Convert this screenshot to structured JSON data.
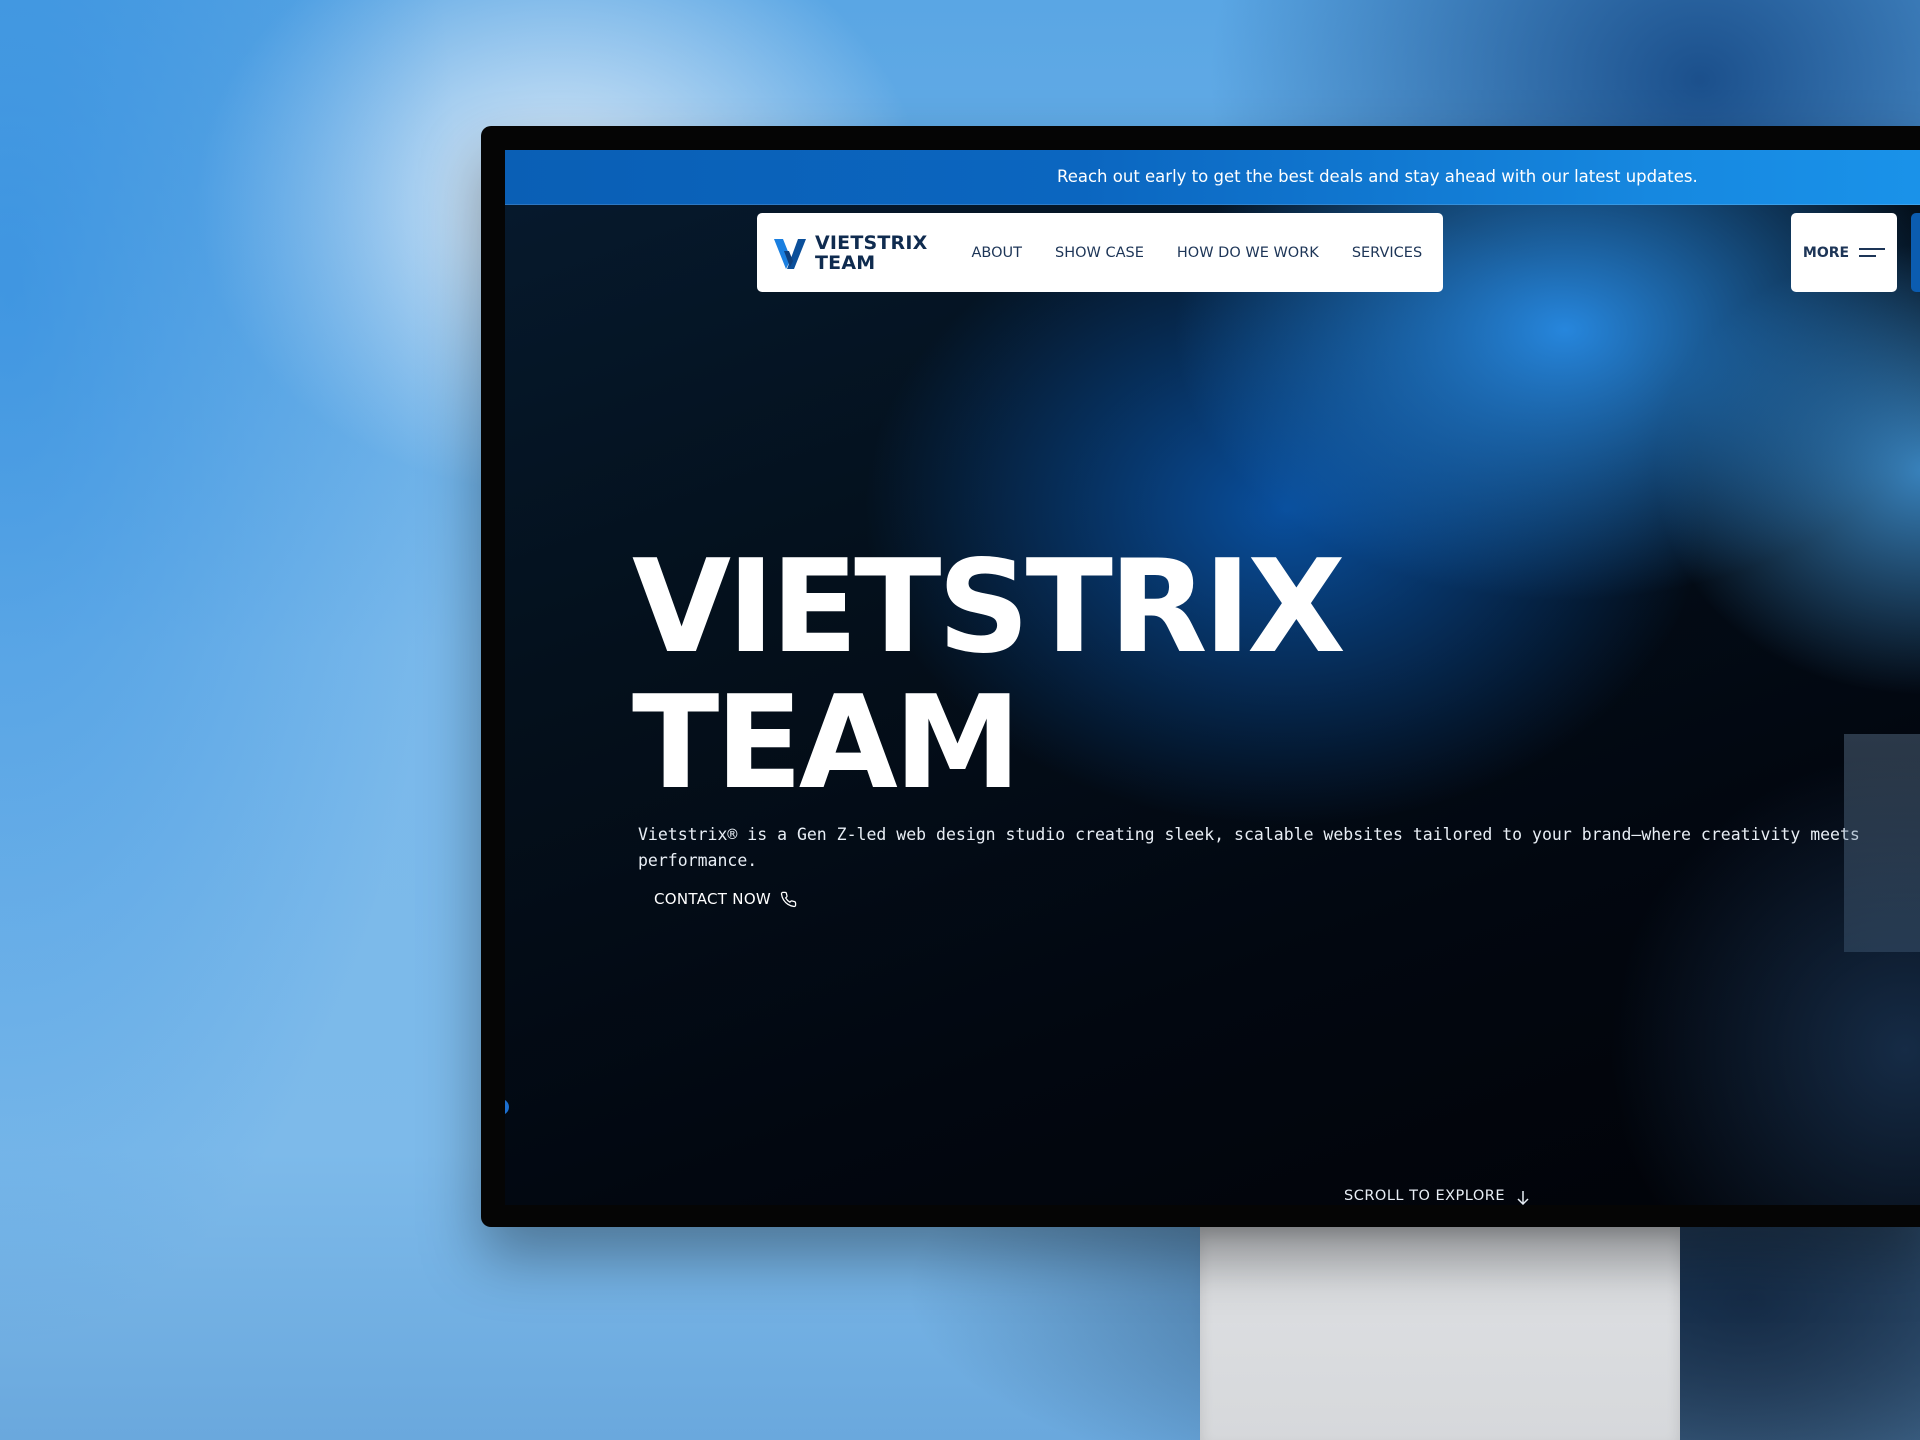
{
  "announcement": {
    "text": "Reach out early to get the best deals and stay ahead with our latest updates."
  },
  "nav": {
    "logo_line1": "VIETSTRIX",
    "logo_line2": "TEAM",
    "links": [
      {
        "label": "ABOUT"
      },
      {
        "label": "SHOW CASE"
      },
      {
        "label": "HOW DO WE WORK"
      },
      {
        "label": "SERVICES"
      }
    ],
    "more_label": "MORE"
  },
  "hero": {
    "title_line1": "VIETSTRIX",
    "title_line2": "TEAM",
    "description": "Vietstrix® is a Gen Z-led web design studio creating sleek, scalable websites tailored to your brand—where creativity meets performance.",
    "contact_label": "CONTACT NOW",
    "scroll_label": "SCROLL TO EXPLORE"
  },
  "colors": {
    "announcement_bar": "#0b66c0",
    "brand_navy": "#0f2b4f",
    "logo_blue": "#1a7fe0",
    "hero_text": "#ffffff"
  },
  "icons": {
    "logo": "v-logo-icon",
    "menu": "hamburger-icon",
    "contact": "phone-icon",
    "scroll": "arrow-down-icon"
  }
}
